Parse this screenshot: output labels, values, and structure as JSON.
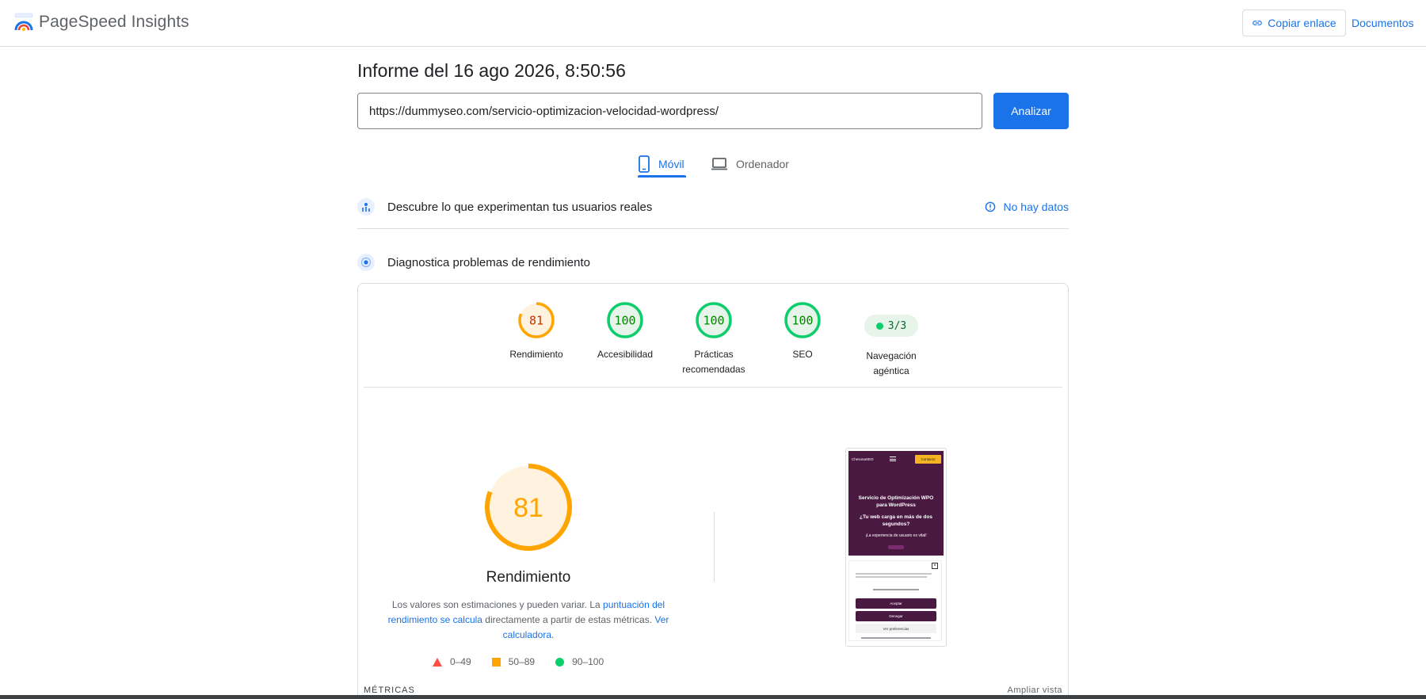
{
  "header": {
    "brand": "PageSpeed Insights",
    "copy_link": "Copiar enlace",
    "docs": "Documentos"
  },
  "report": {
    "title": "Informe del 16 ago 2026, 8:50:56",
    "url_value": "https://dummyseo.com/servicio-optimizacion-velocidad-wordpress/",
    "analyze": "Analizar"
  },
  "tabs": [
    {
      "label": "Móvil",
      "active": true
    },
    {
      "label": "Ordenador",
      "active": false
    }
  ],
  "field_section": {
    "title": "Descubre lo que experimentan tus usuarios reales",
    "status": "No hay datos"
  },
  "lab_section": {
    "title": "Diagnostica problemas de rendimiento"
  },
  "scores": [
    {
      "label": "Rendimiento",
      "value": "81",
      "level": "average"
    },
    {
      "label": "Accesibilidad",
      "value": "100",
      "level": "pass"
    },
    {
      "label": "Prácticas recomendadas",
      "value": "100",
      "level": "pass"
    },
    {
      "label": "SEO",
      "value": "100",
      "level": "pass"
    },
    {
      "label": "Navegación agéntica",
      "value": "3/3",
      "level": "pill"
    }
  ],
  "main_score": {
    "value": "81",
    "label": "Rendimiento",
    "desc_1": "Los valores son estimaciones y pueden variar. La ",
    "link_1": "puntuación del rendimiento se calcula",
    "desc_2": " directamente a partir de estas métricas. ",
    "link_2": "Ver calculadora",
    "desc_3": "."
  },
  "legend": [
    {
      "range": "0–49",
      "shape": "triangle",
      "color": "#ff4e42"
    },
    {
      "range": "50–89",
      "shape": "square",
      "color": "#ffa400"
    },
    {
      "range": "90–100",
      "shape": "circle",
      "color": "#0cce6b"
    }
  ],
  "thumbnail": {
    "brand": "ChesonaSEO",
    "cta": "Contacto",
    "heading_1": "Servicio de Optimización WPO",
    "heading_2": "para WordPress",
    "heading_3": "¿Tu web carga en más de dos",
    "heading_4": "segundos?",
    "sub": "¡La experiencia de usuario es vital!",
    "accept": "Aceptar",
    "deny": "Denegar",
    "prefs": "Ver preferencias"
  },
  "metrics": {
    "label": "MÉTRICAS",
    "expand": "Ampliar vista"
  },
  "colors": {
    "accent": "#1a73e8",
    "average": "#ffa400",
    "pass": "#0cce6b",
    "fail": "#ff4e42"
  }
}
